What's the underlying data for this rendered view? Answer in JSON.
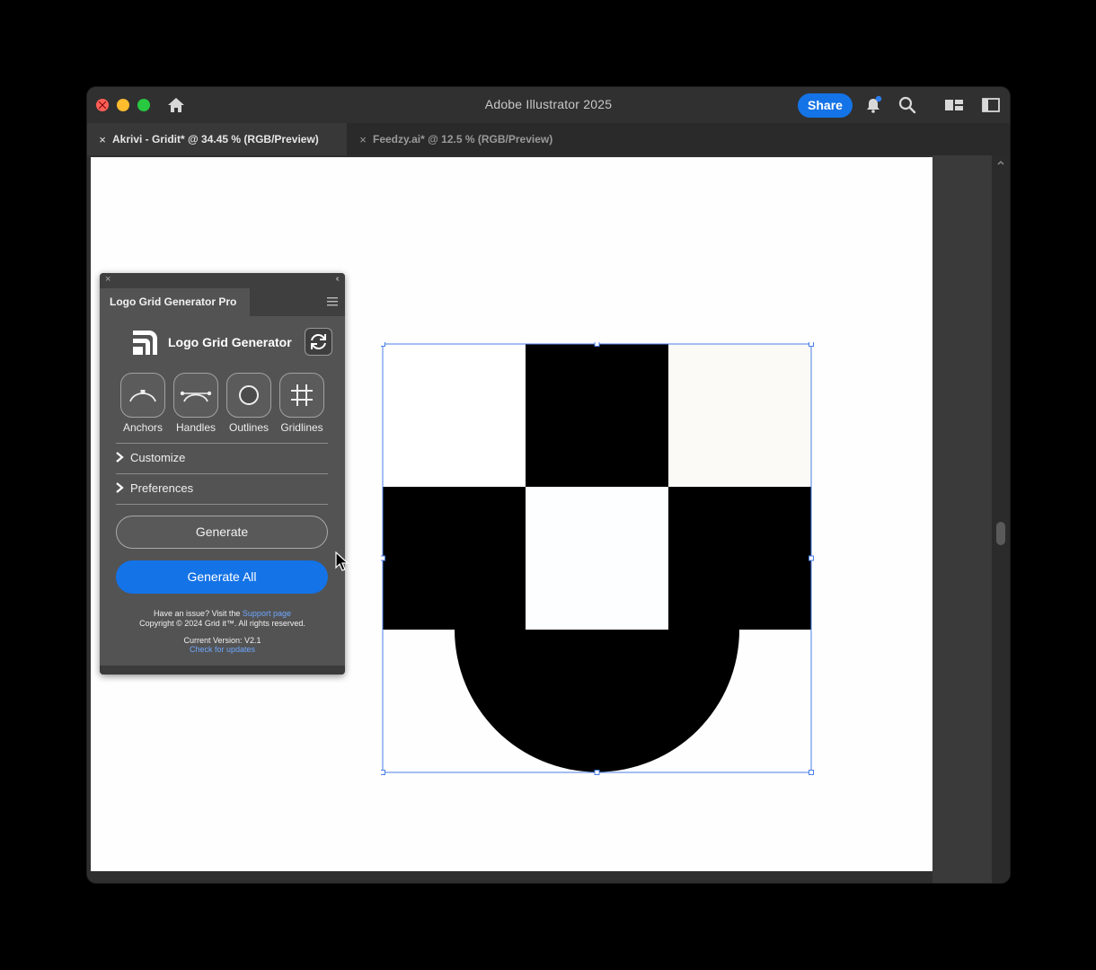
{
  "window": {
    "title": "Adobe Illustrator 2025",
    "share_label": "Share"
  },
  "tabs": [
    {
      "label": "Akrivi - Gridit* @ 34.45 % (RGB/Preview)",
      "close": "×"
    },
    {
      "label": "Feedzy.ai* @ 12.5 % (RGB/Preview)",
      "close": "×"
    }
  ],
  "panel": {
    "tab_label": "Logo Grid Generator Pro",
    "close": "×",
    "collapse": "‹‹",
    "brand_name": "Logo Grid Generator",
    "tools": [
      {
        "label": "Anchors",
        "icon": "anchors-icon"
      },
      {
        "label": "Handles",
        "icon": "handles-icon"
      },
      {
        "label": "Outlines",
        "icon": "outlines-icon"
      },
      {
        "label": "Gridlines",
        "icon": "gridlines-icon"
      }
    ],
    "sections": [
      {
        "label": "Customize"
      },
      {
        "label": "Preferences"
      }
    ],
    "generate_label": "Generate",
    "generate_all_label": "Generate All",
    "footer": {
      "issue_prefix": "Have an issue? Visit the ",
      "support_link": "Support page",
      "copyright": "Copyright © 2024 Grid it™. All rights reserved.",
      "version": "Current Version: V2.1",
      "updates_link": "Check for updates"
    }
  },
  "colors": {
    "accent": "#1473e6",
    "selection": "#4a7ee8",
    "artwork": "#000000",
    "artboard": "#fefefe"
  }
}
